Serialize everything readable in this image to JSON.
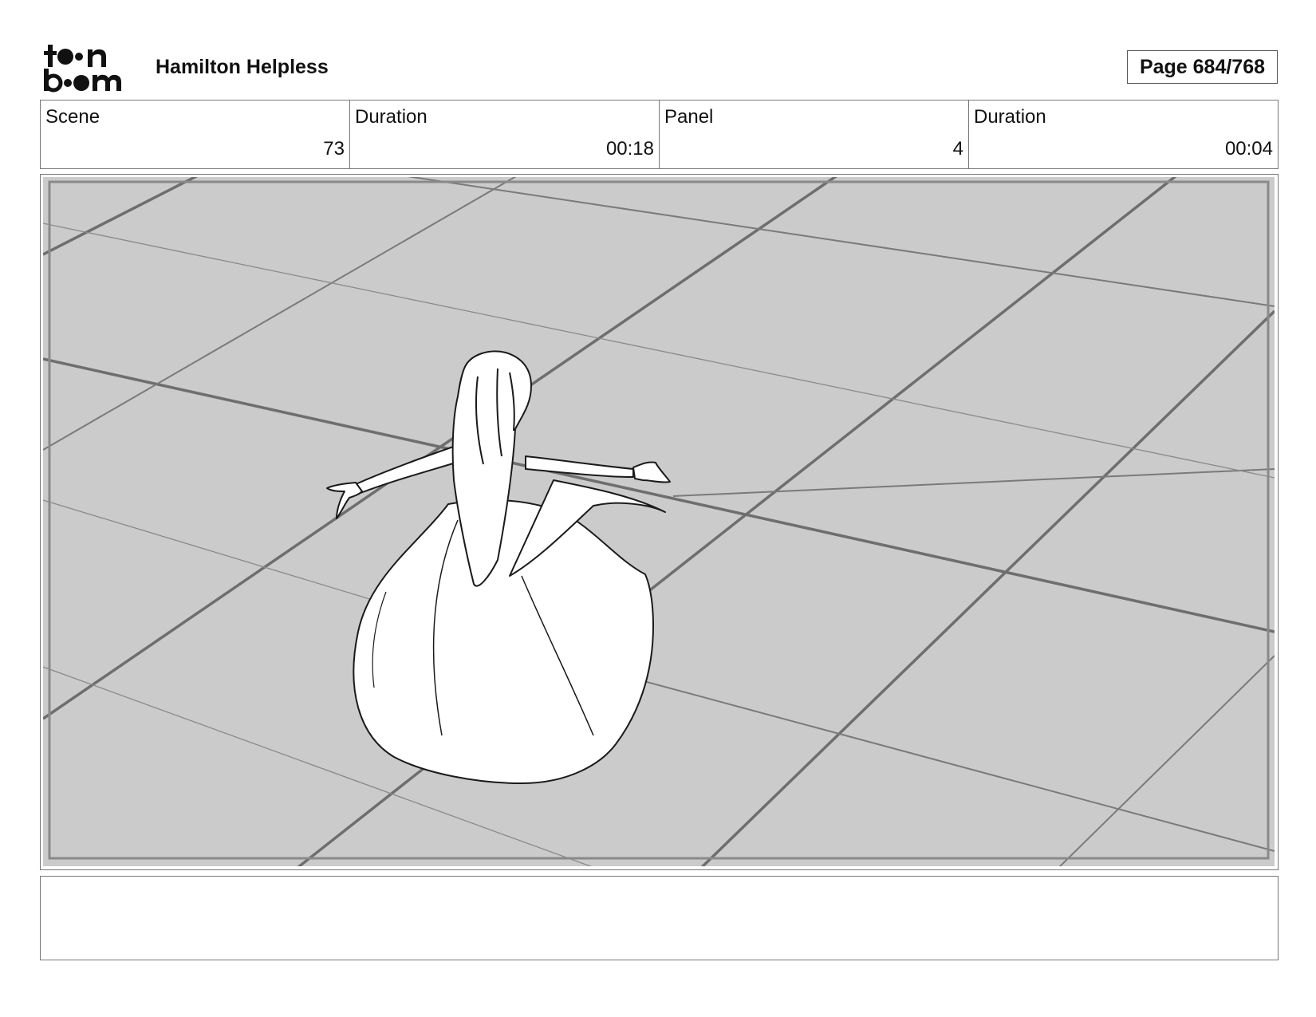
{
  "header": {
    "logo_text": "toon boom",
    "project_title": "Hamilton Helpless",
    "page_label": "Page 684/768"
  },
  "info": {
    "scene_label": "Scene",
    "scene_value": "73",
    "scene_duration_label": "Duration",
    "scene_duration_value": "00:18",
    "panel_label": "Panel",
    "panel_value": "4",
    "panel_duration_label": "Duration",
    "panel_duration_value": "00:04"
  },
  "panel": {
    "floor_color": "#cbcbcb",
    "line_color": "#6e6e6e"
  },
  "notes": {
    "text": ""
  }
}
